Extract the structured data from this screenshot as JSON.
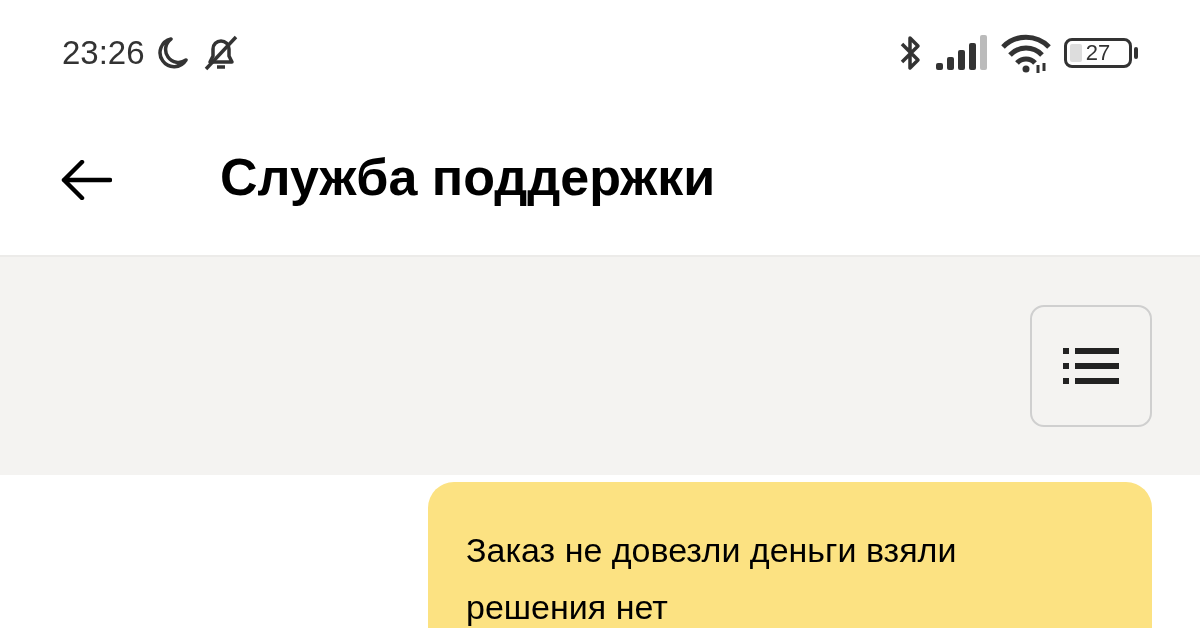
{
  "status_bar": {
    "time": "23:26",
    "battery": "27"
  },
  "header": {
    "title": "Служба поддержки"
  },
  "messages": [
    {
      "kind": "outgoing",
      "text": "Заказ не довезли деньги взяли решения нет"
    }
  ]
}
